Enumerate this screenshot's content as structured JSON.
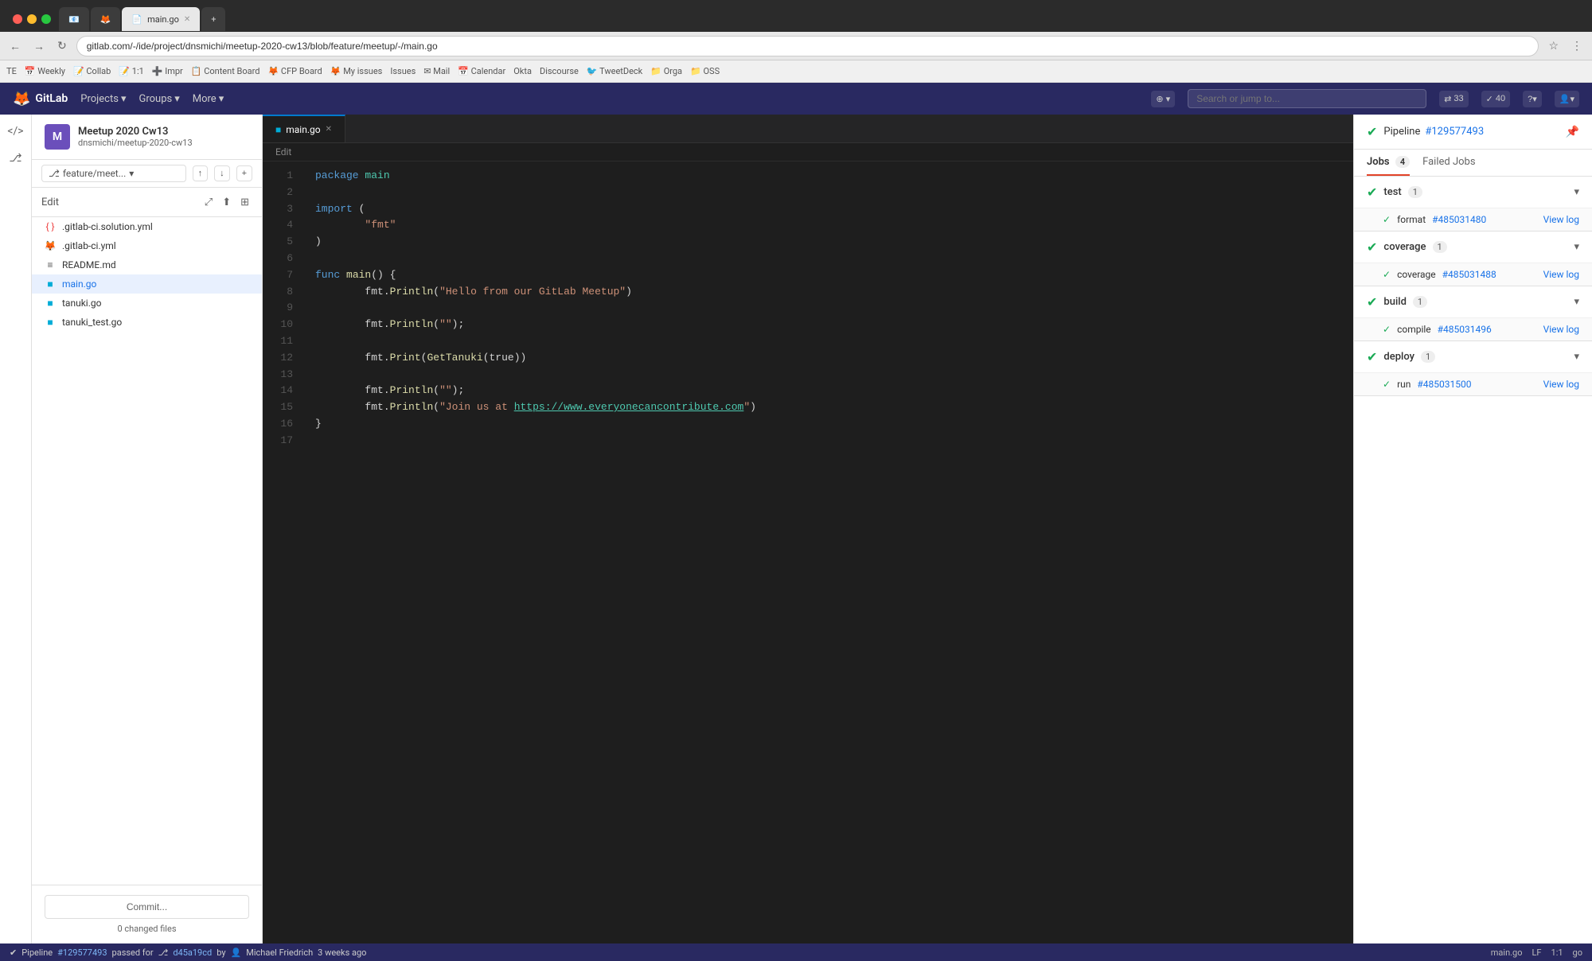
{
  "browser": {
    "tabs": [
      {
        "label": "M",
        "active": false
      },
      {
        "label": "◆",
        "active": false
      },
      {
        "label": "main.go",
        "active": true
      },
      {
        "label": "+",
        "active": false
      }
    ],
    "url": "gitlab.com/-/ide/project/dnsmichi/meetup-2020-cw13/blob/feature/meetup/-/main.go",
    "bookmarks": [
      "TE",
      "Weekly",
      "Collab",
      "1:1",
      "Impr",
      "Content Board",
      "CFP Board",
      "My issues",
      "Issues",
      "Mail",
      "Calendar",
      "Okta",
      "Discourse",
      "TweetDeck",
      "Orga",
      "OSS"
    ]
  },
  "gitlab_nav": {
    "logo": "GitLab",
    "menu_items": [
      "Projects",
      "Groups",
      "More"
    ],
    "search_placeholder": "Search or jump to...",
    "nav_counts": {
      "merge": "33",
      "todo": "40"
    }
  },
  "sidebar": {
    "project_name": "Meetup 2020 Cw13",
    "project_path": "dnsmichi/meetup-2020-cw13",
    "project_initial": "M",
    "branch": "feature/meet...",
    "edit_label": "Edit",
    "files": [
      {
        "name": ".gitlab-ci.solution.yml",
        "type": "yaml",
        "active": false
      },
      {
        "name": ".gitlab-ci.yml",
        "type": "yaml",
        "active": false
      },
      {
        "name": "README.md",
        "type": "md",
        "active": false
      },
      {
        "name": "main.go",
        "type": "go",
        "active": true
      },
      {
        "name": "tanuki.go",
        "type": "go",
        "active": false
      },
      {
        "name": "tanuki_test.go",
        "type": "go",
        "active": false
      }
    ],
    "commit_btn": "Commit...",
    "changed_files": "0 changed files"
  },
  "editor": {
    "tab_label": "main.go",
    "breadcrumb": "Edit",
    "lines": [
      {
        "num": 1,
        "code": "package main",
        "type": "pkg"
      },
      {
        "num": 2,
        "code": ""
      },
      {
        "num": 3,
        "code": "import ("
      },
      {
        "num": 4,
        "code": "    \"fmt\"",
        "type": "str"
      },
      {
        "num": 5,
        "code": ")"
      },
      {
        "num": 6,
        "code": ""
      },
      {
        "num": 7,
        "code": "func main() {"
      },
      {
        "num": 8,
        "code": "    fmt.Println(\"Hello from our GitLab Meetup\")"
      },
      {
        "num": 9,
        "code": ""
      },
      {
        "num": 10,
        "code": "    fmt.Println(\"\");"
      },
      {
        "num": 11,
        "code": ""
      },
      {
        "num": 12,
        "code": "    fmt.Print(GetTanuki(true))"
      },
      {
        "num": 13,
        "code": ""
      },
      {
        "num": 14,
        "code": "    fmt.Println(\"\");"
      },
      {
        "num": 15,
        "code": "    fmt.Println(\"Join us at https://www.everyonecancontribute.com\")"
      },
      {
        "num": 16,
        "code": "}"
      },
      {
        "num": 17,
        "code": ""
      }
    ]
  },
  "pipeline": {
    "title": "Pipeline",
    "id": "#129577493",
    "id_link": "#129577493",
    "tabs": [
      {
        "label": "Jobs",
        "count": "4",
        "active": true
      },
      {
        "label": "Failed Jobs",
        "count": "",
        "active": false
      }
    ],
    "stages": [
      {
        "name": "test",
        "count": "1",
        "jobs": [
          {
            "status": "✓",
            "name": "format",
            "id": "#485031480",
            "view_log": "View log"
          }
        ]
      },
      {
        "name": "coverage",
        "count": "1",
        "jobs": [
          {
            "status": "✓",
            "name": "coverage",
            "id": "#485031488",
            "view_log": "View log"
          }
        ]
      },
      {
        "name": "build",
        "count": "1",
        "jobs": [
          {
            "status": "✓",
            "name": "compile",
            "id": "#485031496",
            "view_log": "View log"
          }
        ]
      },
      {
        "name": "deploy",
        "count": "1",
        "jobs": [
          {
            "status": "✓",
            "name": "run",
            "id": "#485031500",
            "view_log": "View log"
          }
        ]
      }
    ]
  },
  "status_bar": {
    "pipeline_text": "Pipeline",
    "pipeline_id": "#129577493",
    "pipeline_status": "passed for",
    "commit_hash": "d45a19cd",
    "commit_author": "Michael Friedrich",
    "commit_time": "3 weeks ago",
    "right": {
      "filename": "main.go",
      "encoding": "LF",
      "position": "1:1",
      "language": "go"
    }
  }
}
